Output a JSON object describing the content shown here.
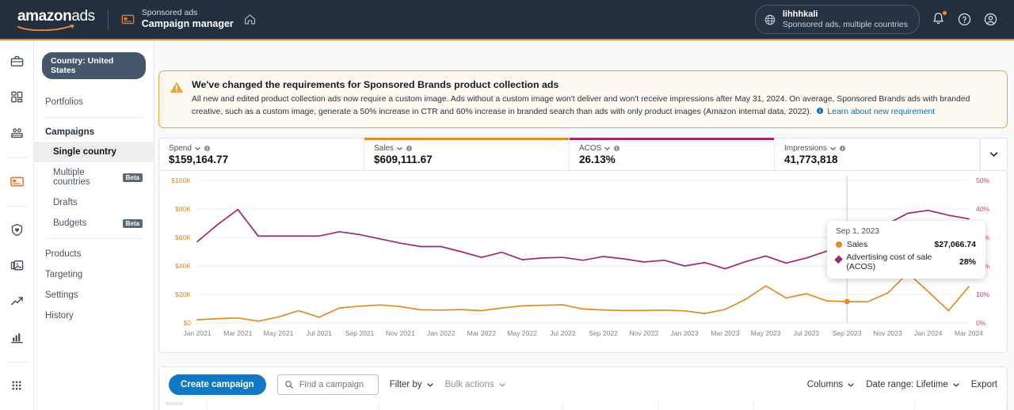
{
  "topbar": {
    "brand_first": "amazon",
    "brand_second": "ads",
    "app_line1": "Sponsored ads",
    "app_line2": "Campaign manager",
    "home_icon": "home-icon",
    "card_icon": "ad-card-icon",
    "account_name": "lihhhkali",
    "account_sub": "Sponsored ads, multiple countries",
    "globe_icon": "globe-icon",
    "bell_icon": "bell-icon",
    "help_icon": "help-circle-icon",
    "profile_icon": "user-circle-icon"
  },
  "rail": {
    "items": [
      {
        "icon": "briefcase-icon",
        "active": false
      },
      {
        "icon": "dashboard-grid-icon",
        "active": false
      },
      {
        "icon": "audience-icon",
        "active": false
      },
      {
        "icon": "ad-card-icon",
        "active": true
      },
      {
        "icon": "shield-icon",
        "active": false
      },
      {
        "icon": "creative-media-icon",
        "active": false
      },
      {
        "icon": "trending-up-icon",
        "active": false
      },
      {
        "icon": "bar-chart-icon",
        "active": false
      },
      {
        "icon": "apps-grid-icon",
        "active": false
      }
    ]
  },
  "nav": {
    "country_pill": "Country: United States",
    "portfolios": "Portfolios",
    "campaigns_head": "Campaigns",
    "campaign_items": [
      {
        "label": "Single country",
        "badge": "",
        "selected": true
      },
      {
        "label": "Multiple countries",
        "badge": "Beta",
        "selected": false
      },
      {
        "label": "Drafts",
        "badge": "",
        "selected": false
      },
      {
        "label": "Budgets",
        "badge": "Beta",
        "selected": false
      }
    ],
    "other_items": [
      {
        "label": "Products"
      },
      {
        "label": "Targeting"
      },
      {
        "label": "Settings"
      },
      {
        "label": "History"
      }
    ]
  },
  "alert": {
    "icon": "warning-triangle-icon",
    "title": "We've changed the requirements for Sponsored Brands product collection ads",
    "body": "All new and edited product collection ads now require a custom image. Ads without a custom image won't deliver and won't receive impressions after May 31, 2024. On average, Sponsored Brands ads with branded creative, such as a custom image, generate a 50% increase in CTR and 60% increase in branded search than ads with only product images (Amazon internal data, 2022).",
    "link": "Learn about new requirement",
    "link_icon": "info-circle-icon"
  },
  "metrics": [
    {
      "label": "Spend",
      "value": "$159,164.77",
      "accent": ""
    },
    {
      "label": "Sales",
      "value": "$609,111.67",
      "accent": "#e18b25"
    },
    {
      "label": "ACOS",
      "value": "26.13%",
      "accent": "#9e2a6e"
    },
    {
      "label": "Impressions",
      "value": "41,773,818",
      "accent": ""
    }
  ],
  "metric_icons": {
    "chevron": "chevron-down-icon",
    "info": "info-circle-icon",
    "expand": "chevron-down-icon"
  },
  "tooltip": {
    "date": "Sep 1, 2023",
    "rows": [
      {
        "marker": "circle",
        "name": "Sales",
        "value": "$27,066.74",
        "color": "#e18b25"
      },
      {
        "marker": "diamond",
        "name": "Advertising cost of sale (ACOS)",
        "value": "28%",
        "color": "#9e2a6e"
      }
    ]
  },
  "toolbar": {
    "create_label": "Create campaign",
    "search_placeholder": "Find a campaign",
    "search_value": "",
    "search_icon": "search-icon",
    "filter_label": "Filter by",
    "bulk_label": "Bulk actions",
    "columns_label": "Columns",
    "date_range_label": "Date range: Lifetime",
    "export_label": "Export",
    "chevron": "chevron-down-icon"
  },
  "chart_data": {
    "type": "line",
    "title": "",
    "xlabel": "",
    "ylabel": "",
    "grid": true,
    "legend_position": "tooltip",
    "x_ticks": [
      "Jan 2021",
      "Mar 2021",
      "May 2021",
      "Jul 2021",
      "Sep 2021",
      "Nov 2021",
      "Jan 2022",
      "Mar 2022",
      "May 2022",
      "Jul 2022",
      "Sep 2022",
      "Nov 2022",
      "Jan 2023",
      "Mar 2023",
      "May 2023",
      "Jul 2023",
      "Sep 2023",
      "Nov 2023",
      "Jan 2024",
      "Mar 2024"
    ],
    "left_axis": {
      "label": "Sales",
      "ticks": [
        "$0",
        "$20K",
        "$40K",
        "$60K",
        "$80K",
        "$100K"
      ],
      "min": 0,
      "max": 100000,
      "color": "#e18b25"
    },
    "right_axis": {
      "label": "ACOS",
      "ticks": [
        "0%",
        "10%",
        "20%",
        "30%",
        "40%",
        "50%"
      ],
      "min": 0,
      "max": 50,
      "color": "#c2437f"
    },
    "x": [
      "Jan 2021",
      "Feb 2021",
      "Mar 2021",
      "Apr 2021",
      "May 2021",
      "Jun 2021",
      "Jul 2021",
      "Aug 2021",
      "Sep 2021",
      "Oct 2021",
      "Nov 2021",
      "Dec 2021",
      "Jan 2022",
      "Feb 2022",
      "Mar 2022",
      "Apr 2022",
      "May 2022",
      "Jun 2022",
      "Jul 2022",
      "Aug 2022",
      "Sep 2022",
      "Oct 2022",
      "Nov 2022",
      "Dec 2022",
      "Jan 2023",
      "Feb 2023",
      "Mar 2023",
      "Apr 2023",
      "May 2023",
      "Jun 2023",
      "Jul 2023",
      "Aug 2023",
      "Sep 2023",
      "Oct 2023",
      "Nov 2023",
      "Dec 2023",
      "Jan 2024",
      "Feb 2024",
      "Mar 2024"
    ],
    "series": [
      {
        "name": "Sales",
        "axis": "left",
        "color": "#e18b25",
        "marker": "circle",
        "unit": "USD",
        "values": [
          2200,
          3000,
          3500,
          1200,
          4200,
          8600,
          4000,
          10500,
          11800,
          12600,
          11500,
          9200,
          9000,
          9400,
          8600,
          10500,
          12000,
          12400,
          12700,
          9800,
          9100,
          8700,
          8800,
          9000,
          8500,
          6600,
          9500,
          16500,
          26000,
          17500,
          20500,
          15500,
          15000,
          14800,
          21000,
          35000,
          22000,
          8600,
          25500
        ]
      },
      {
        "name": "Advertising cost of sale (ACOS)",
        "axis": "right",
        "color": "#9e2a6e",
        "marker": "diamond",
        "unit": "percent",
        "values": [
          28.5,
          34.5,
          39.8,
          30.5,
          30.5,
          30.5,
          30.5,
          32.0,
          31.0,
          29.5,
          28.0,
          26.8,
          26.8,
          25.0,
          23.0,
          24.8,
          22.2,
          22.8,
          23.0,
          22.0,
          23.3,
          22.5,
          21.4,
          22.0,
          20.0,
          21.2,
          19.0,
          21.5,
          23.5,
          21.0,
          22.8,
          25.2,
          28.0,
          31.5,
          34.8,
          38.5,
          39.5,
          37.8,
          36.5
        ]
      }
    ],
    "hover": {
      "x": "Sep 2023",
      "sales": "$27,066.74",
      "acos": "28%"
    }
  }
}
